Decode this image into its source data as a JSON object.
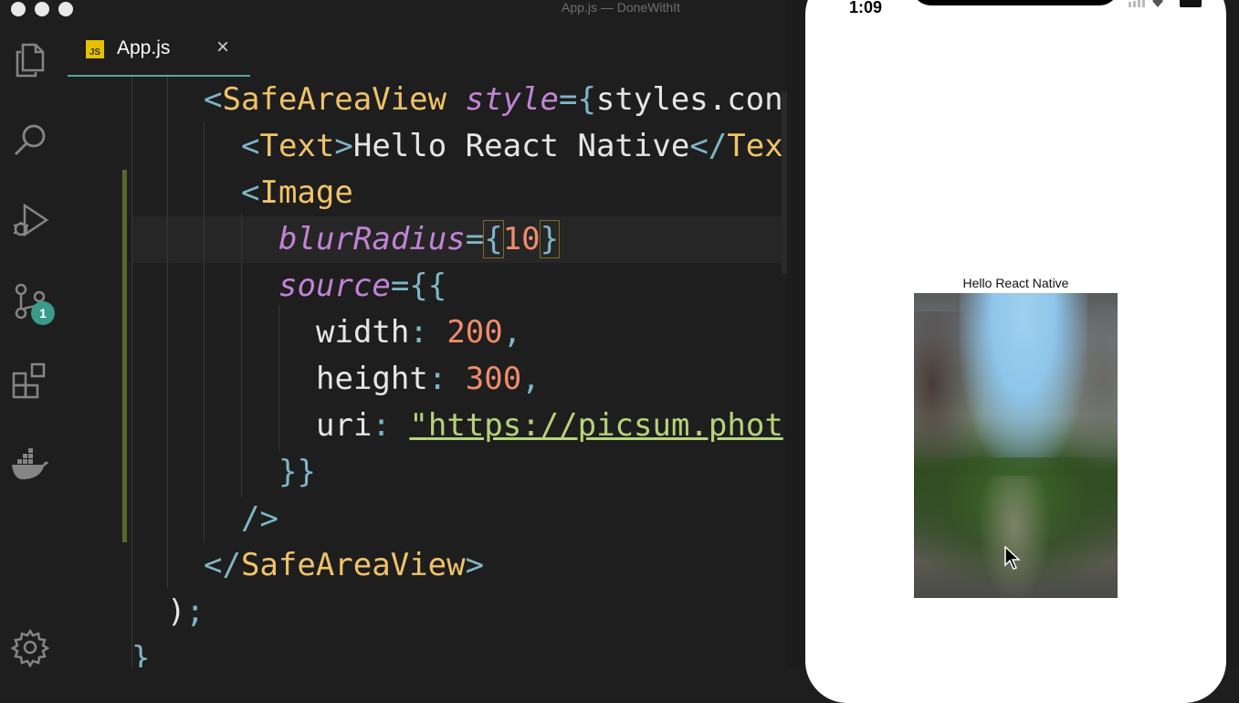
{
  "window": {
    "title": "App.js — DoneWithIt"
  },
  "activity_bar": {
    "items": [
      {
        "name": "explorer",
        "icon": "files-icon"
      },
      {
        "name": "search",
        "icon": "search-icon"
      },
      {
        "name": "run-debug",
        "icon": "run-debug-icon"
      },
      {
        "name": "source-control",
        "icon": "source-control-icon",
        "badge": "1"
      },
      {
        "name": "extensions",
        "icon": "extensions-icon"
      },
      {
        "name": "docker",
        "icon": "docker-icon"
      }
    ],
    "settings_icon": "gear-icon",
    "badge_color": "#3a9a8c"
  },
  "editor": {
    "tab": {
      "label": "App.js",
      "file_type": "JS",
      "close": "×"
    },
    "lines": {
      "l1_tag": "SafeAreaView",
      "l1_attr": "style",
      "l1_value": "styles.con",
      "l2_text": "Hello React Native",
      "l2_close": "Tex",
      "l3_tag": "Image",
      "l4_attr": "blurRadius",
      "l4_value": "10",
      "l5_attr": "source",
      "l6_key": "width",
      "l6_value": "200",
      "l7_key": "height",
      "l7_value": "300",
      "l8_key": "uri",
      "l8_value": "https://picsum.phot",
      "l11_tag": "SafeAreaView"
    }
  },
  "simulator": {
    "status_time": "1:09",
    "hello_text": "Hello React Native"
  }
}
